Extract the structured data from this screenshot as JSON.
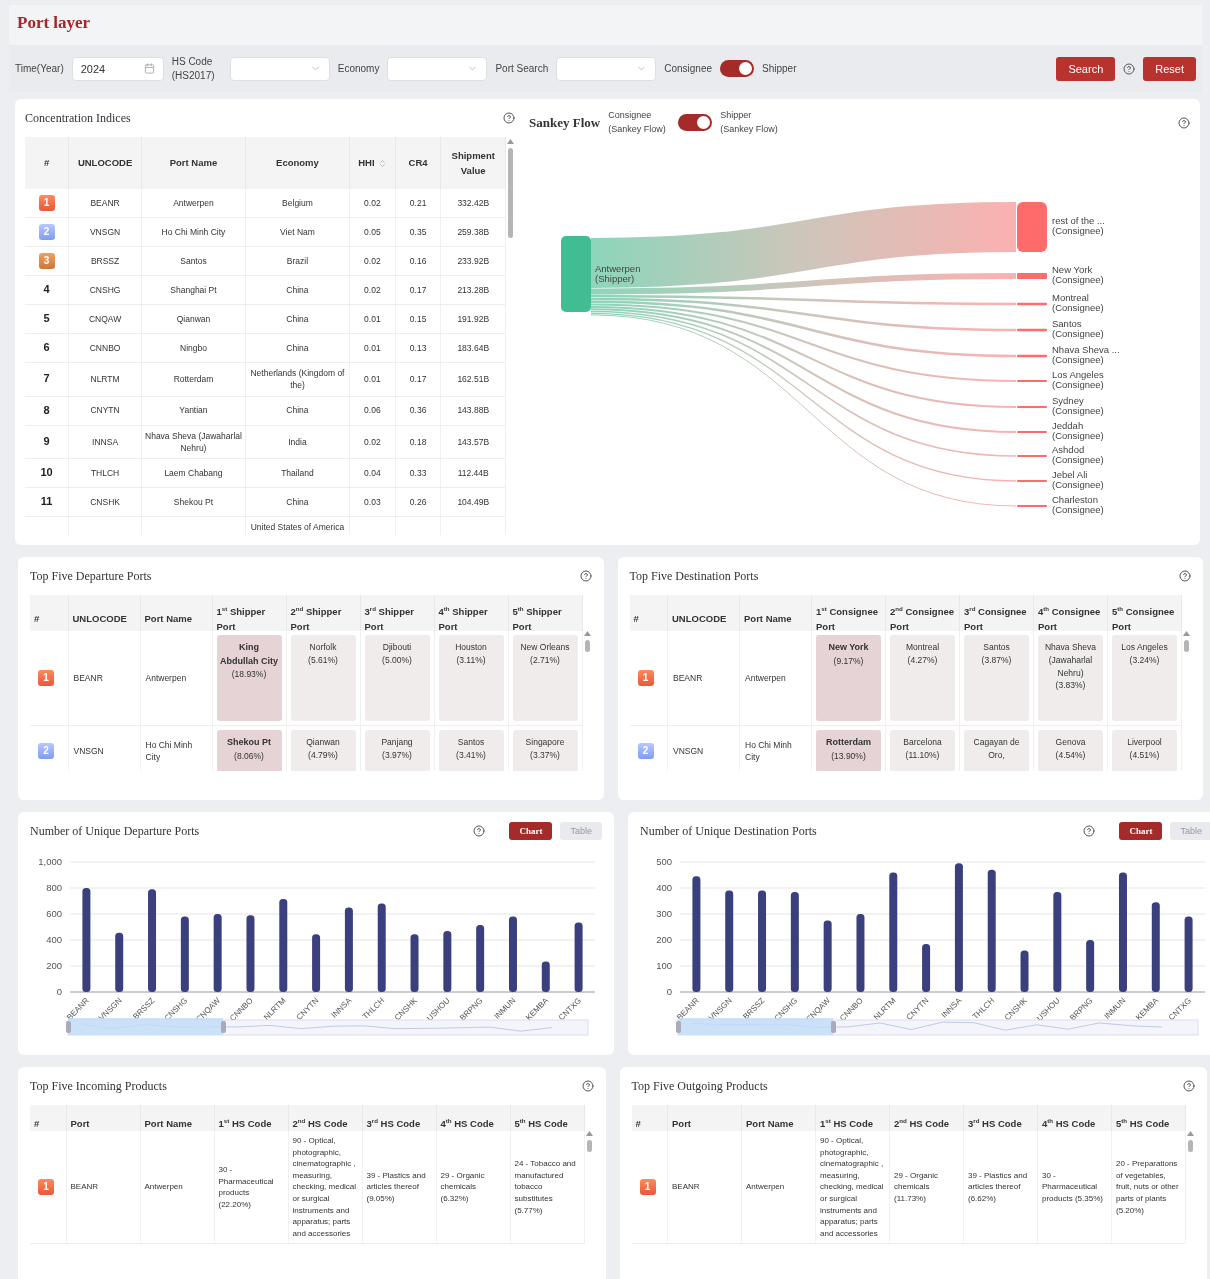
{
  "header": {
    "title": "Port layer"
  },
  "filters": {
    "year_label": "Time(Year)",
    "year": "2024",
    "hs_label": "HS Code (HS2017)",
    "economy_label": "Economy",
    "port_label": "Port Search",
    "consignee_label": "Consignee",
    "shipper_label": "Shipper",
    "shipper_on": true,
    "buttons": [
      "Search",
      "Reset"
    ]
  },
  "concentration": {
    "title": "Concentration Indices",
    "columns": [
      "#",
      "UNLOCODE",
      "Port Name",
      "Economy",
      "HHI",
      "CR4",
      "Shipment Value"
    ],
    "rows": [
      {
        "rank": "1",
        "unlocode": "BEANR",
        "port": "Antwerpen",
        "economy": "Belgium",
        "hhi": "0.02",
        "cr4": "0.21",
        "value": "332.42B"
      },
      {
        "rank": "2",
        "unlocode": "VNSGN",
        "port": "Ho Chi Minh City",
        "economy": "Viet Nam",
        "hhi": "0.05",
        "cr4": "0.35",
        "value": "259.38B"
      },
      {
        "rank": "3",
        "unlocode": "BRSSZ",
        "port": "Santos",
        "economy": "Brazil",
        "hhi": "0.02",
        "cr4": "0.16",
        "value": "233.92B"
      },
      {
        "rank": "4",
        "unlocode": "CNSHG",
        "port": "Shanghai Pt",
        "economy": "China",
        "hhi": "0.02",
        "cr4": "0.17",
        "value": "213.28B"
      },
      {
        "rank": "5",
        "unlocode": "CNQAW",
        "port": "Qianwan",
        "economy": "China",
        "hhi": "0.01",
        "cr4": "0.15",
        "value": "191.92B"
      },
      {
        "rank": "6",
        "unlocode": "CNNBO",
        "port": "Ningbo",
        "economy": "China",
        "hhi": "0.01",
        "cr4": "0.13",
        "value": "183.64B"
      },
      {
        "rank": "7",
        "unlocode": "NLRTM",
        "port": "Rotterdam",
        "economy": "Netherlands (Kingdom of the)",
        "hhi": "0.01",
        "cr4": "0.17",
        "value": "162.51B"
      },
      {
        "rank": "8",
        "unlocode": "CNYTN",
        "port": "Yantian",
        "economy": "China",
        "hhi": "0.06",
        "cr4": "0.36",
        "value": "143.88B"
      },
      {
        "rank": "9",
        "unlocode": "INNSA",
        "port": "Nhava Sheva (Jawaharlal Nehru)",
        "economy": "India",
        "hhi": "0.02",
        "cr4": "0.18",
        "value": "143.57B"
      },
      {
        "rank": "10",
        "unlocode": "THLCH",
        "port": "Laem Chabang",
        "economy": "Thailand",
        "hhi": "0.04",
        "cr4": "0.33",
        "value": "112.44B"
      },
      {
        "rank": "11",
        "unlocode": "CNSHK",
        "port": "Shekou Pt",
        "economy": "China",
        "hhi": "0.03",
        "cr4": "0.26",
        "value": "104.49B"
      },
      {
        "economy": "United States of America"
      }
    ]
  },
  "sankey": {
    "title": "Sankey Flow",
    "left_label": "Consignee (Sankey Flow)",
    "right_label": "Shipper (Sankey Flow)",
    "shipper_on": true,
    "source": {
      "name": "Antwerpen",
      "role": "(Shipper)"
    },
    "targets": [
      {
        "name": "rest of the ...",
        "role": "(Consignee)"
      },
      {
        "name": "New York",
        "role": "(Consignee)"
      },
      {
        "name": "Montreal",
        "role": "(Consignee)"
      },
      {
        "name": "Santos",
        "role": "(Consignee)"
      },
      {
        "name": "Nhava Sheva ...",
        "role": "(Consignee)"
      },
      {
        "name": "Los Angeles",
        "role": "(Consignee)"
      },
      {
        "name": "Sydney",
        "role": "(Consignee)"
      },
      {
        "name": "Jeddah",
        "role": "(Consignee)"
      },
      {
        "name": "Ashdod",
        "role": "(Consignee)"
      },
      {
        "name": "Jebel Ali",
        "role": "(Consignee)"
      },
      {
        "name": "Charleston",
        "role": "(Consignee)"
      }
    ]
  },
  "departures": {
    "title": "Top Five Departure Ports",
    "columns": [
      "#",
      "UNLOCODE",
      "Port Name",
      "1$^{st}$ Shipper Port",
      "2$^{nd}$ Shipper Port",
      "3$^{rd}$ Shipper Port",
      "4$^{th}$ Shipper Port",
      "5$^{th}$ Shipper Port"
    ],
    "rows": [
      {
        "cells": [
          {
            "text": "1"
          },
          {
            "text": "BEANR"
          },
          {
            "text": "Antwerpen"
          },
          {
            "text": "King Abdullah City",
            "share": "(18.93%)",
            "strong": true
          },
          {
            "text": "Norfolk",
            "share": "(5.61%)",
            "strong": false
          },
          {
            "text": "Djibouti",
            "share": "(5.00%)",
            "strong": false
          },
          {
            "text": "Houston",
            "share": "(3.11%)",
            "strong": false
          },
          {
            "text": "New Orleans",
            "share": "(2.71%)",
            "strong": false
          }
        ]
      },
      {
        "cells": [
          {
            "text": "2"
          },
          {
            "text": "VNSGN"
          },
          {
            "text": "Ho Chi Minh City"
          },
          {
            "text": "Shekou Pt",
            "share": "(8.06%)",
            "strong": true
          },
          {
            "text": "Qianwan",
            "share": "(4.79%)",
            "strong": false
          },
          {
            "text": "Panjang",
            "share": "(3.97%)",
            "strong": false
          },
          {
            "text": "Santos",
            "share": "(3.41%)",
            "strong": false
          },
          {
            "text": "Singapore",
            "share": "(3.37%)",
            "strong": false
          }
        ]
      }
    ]
  },
  "destinations": {
    "title": "Top Five Destination Ports",
    "columns": [
      "#",
      "UNLOCODE",
      "Port Name",
      "1$^{st}$ Consignee Port",
      "2$^{nd}$ Consignee Port",
      "3$^{rd}$ Consignee Port",
      "4$^{th}$ Consignee Port",
      "5$^{th}$ Consignee Port"
    ],
    "rows": [
      {
        "cells": [
          {
            "text": "1"
          },
          {
            "text": "BEANR"
          },
          {
            "text": "Antwerpen"
          },
          {
            "text": "New York",
            "share": "(9.17%)",
            "strong": true
          },
          {
            "text": "Montreal",
            "share": "(4.27%)",
            "strong": false
          },
          {
            "text": "Santos",
            "share": "(3.87%)",
            "strong": false
          },
          {
            "text": "Nhava Sheva (Jawaharlal Nehru)",
            "share": "(3.83%)",
            "strong": false
          },
          {
            "text": "Los Angeles",
            "share": "(3.24%)",
            "strong": false
          }
        ]
      },
      {
        "cells": [
          {
            "text": "2"
          },
          {
            "text": "VNSGN"
          },
          {
            "text": "Ho Chi Minh City"
          },
          {
            "text": "Rotterdam",
            "share": "(13.90%)",
            "strong": true
          },
          {
            "text": "Barcelona",
            "share": "(11.10%)",
            "strong": false
          },
          {
            "text": "Cagayan de Oro,",
            "strong": false
          },
          {
            "text": "Genova",
            "share": "(4.54%)",
            "strong": false
          },
          {
            "text": "Liverpool",
            "share": "(4.51%)",
            "strong": false
          }
        ]
      }
    ]
  },
  "unique_departures": {
    "title": "Number of Unique Departure Ports",
    "views": [
      {
        "label": "Chart",
        "selected": true
      },
      {
        "label": "Table",
        "selected": false
      }
    ],
    "chart_data": {
      "type": "bar",
      "grid": true,
      "categories": [
        "BEANR",
        "VNSGN",
        "BRSSZ",
        "CNSHG",
        "CNQAW",
        "CNNBO",
        "NLRTM",
        "CNYTN",
        "INNSA",
        "THLCH",
        "CNSHK",
        "USHOU",
        "BRPNG",
        "INMUN",
        "KEMBA",
        "CNTXG"
      ],
      "values": [
        800,
        455,
        790,
        580,
        600,
        590,
        715,
        445,
        650,
        680,
        445,
        470,
        515,
        580,
        235,
        535
      ],
      "ylim": [
        0,
        1000
      ],
      "yticks": [
        0,
        200,
        400,
        600,
        800,
        {
          "value": 1000,
          "label": "1,000"
        }
      ]
    }
  },
  "unique_destinations": {
    "title": "Number of Unique Destination Ports",
    "views": [
      {
        "label": "Chart",
        "selected": true
      },
      {
        "label": "Table",
        "selected": false
      }
    ],
    "chart_data": {
      "type": "bar",
      "grid": true,
      "categories": [
        "BEANR",
        "VNSGN",
        "BRSSZ",
        "CNSHG",
        "CNQAW",
        "CNNBO",
        "NLRTM",
        "CNYTN",
        "INNSA",
        "THLCH",
        "CNSHK",
        "USHOU",
        "BRPNG",
        "INMUN",
        "KEMBA",
        "CNTXG"
      ],
      "values": [
        445,
        390,
        390,
        385,
        275,
        300,
        460,
        185,
        495,
        470,
        160,
        385,
        200,
        460,
        345,
        290
      ],
      "ylim": [
        0,
        500
      ],
      "yticks": [
        0,
        100,
        200,
        300,
        400,
        500
      ]
    }
  },
  "incoming": {
    "title": "Top Five Incoming Products",
    "columns": [
      "#",
      "Port",
      "Port Name",
      "1$^{st}$ HS Code",
      "2$^{nd}$ HS Code",
      "3$^{rd}$ HS Code",
      "4$^{th}$ HS Code",
      "5$^{th}$ HS Code"
    ],
    "rows": [
      {
        "cells": [
          "1",
          "BEANR",
          "Antwerpen",
          "30 - Pharmaceutical products (22.20%)",
          "90 - Optical, photographic, cinematographic , measuring, checking, medical or surgical instruments and apparatus; parts and accessories",
          "39 - Plastics and articles thereof (9.05%)",
          "29 - Organic chemicals (6.32%)",
          "24 - Tobacco and manufactured tobacco substitutes (5.77%)"
        ]
      }
    ]
  },
  "outgoing": {
    "title": "Top Five Outgoing Products",
    "columns": [
      "#",
      "Port",
      "Port Name",
      "1$^{st}$ HS Code",
      "2$^{nd}$ HS Code",
      "3$^{rd}$ HS Code",
      "4$^{th}$ HS Code",
      "5$^{th}$ HS Code"
    ],
    "rows": [
      {
        "cells": [
          "1",
          "BEANR",
          "Antwerpen",
          "90 - Optical, photographic, cinematographic , measuring, checking, medical or surgical instruments and apparatus; parts and accessories",
          "29 - Organic chemicals (11.73%)",
          "39 - Plastics and articles thereof (6.62%)",
          "30 - Pharmaceutical products (5.35%)",
          "20 - Preparations of vegetables, fruit, nuts or other parts of plants (5.20%)"
        ]
      }
    ]
  }
}
